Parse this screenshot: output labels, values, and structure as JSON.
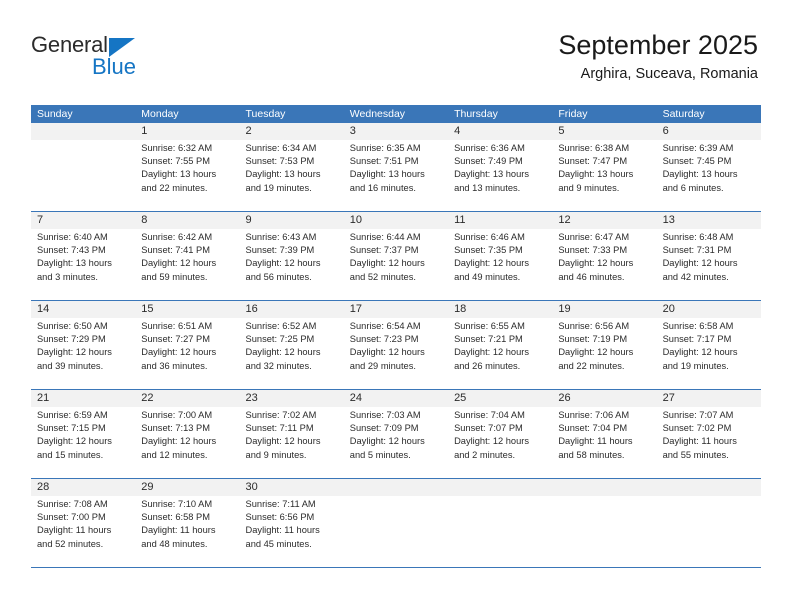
{
  "brand": {
    "name_top": "General",
    "name_bottom": "Blue",
    "triangle_color": "#1575c4"
  },
  "header": {
    "title": "September 2025",
    "subtitle": "Arghira, Suceava, Romania"
  },
  "theme": {
    "header_blue": "#3a76b8",
    "daynum_band": "#f2f2f2",
    "text": "#2b2b2b"
  },
  "calendar": {
    "weekdays": [
      "Sunday",
      "Monday",
      "Tuesday",
      "Wednesday",
      "Thursday",
      "Friday",
      "Saturday"
    ],
    "labels": {
      "sunrise": "Sunrise:",
      "sunset": "Sunset:",
      "daylight": "Daylight:"
    },
    "weeks": [
      [
        {
          "day": "",
          "sunrise": "",
          "sunset": "",
          "daylight_line1": "",
          "daylight_line2": ""
        },
        {
          "day": "1",
          "sunrise": "Sunrise: 6:32 AM",
          "sunset": "Sunset: 7:55 PM",
          "daylight_line1": "Daylight: 13 hours",
          "daylight_line2": "and 22 minutes."
        },
        {
          "day": "2",
          "sunrise": "Sunrise: 6:34 AM",
          "sunset": "Sunset: 7:53 PM",
          "daylight_line1": "Daylight: 13 hours",
          "daylight_line2": "and 19 minutes."
        },
        {
          "day": "3",
          "sunrise": "Sunrise: 6:35 AM",
          "sunset": "Sunset: 7:51 PM",
          "daylight_line1": "Daylight: 13 hours",
          "daylight_line2": "and 16 minutes."
        },
        {
          "day": "4",
          "sunrise": "Sunrise: 6:36 AM",
          "sunset": "Sunset: 7:49 PM",
          "daylight_line1": "Daylight: 13 hours",
          "daylight_line2": "and 13 minutes."
        },
        {
          "day": "5",
          "sunrise": "Sunrise: 6:38 AM",
          "sunset": "Sunset: 7:47 PM",
          "daylight_line1": "Daylight: 13 hours",
          "daylight_line2": "and 9 minutes."
        },
        {
          "day": "6",
          "sunrise": "Sunrise: 6:39 AM",
          "sunset": "Sunset: 7:45 PM",
          "daylight_line1": "Daylight: 13 hours",
          "daylight_line2": "and 6 minutes."
        }
      ],
      [
        {
          "day": "7",
          "sunrise": "Sunrise: 6:40 AM",
          "sunset": "Sunset: 7:43 PM",
          "daylight_line1": "Daylight: 13 hours",
          "daylight_line2": "and 3 minutes."
        },
        {
          "day": "8",
          "sunrise": "Sunrise: 6:42 AM",
          "sunset": "Sunset: 7:41 PM",
          "daylight_line1": "Daylight: 12 hours",
          "daylight_line2": "and 59 minutes."
        },
        {
          "day": "9",
          "sunrise": "Sunrise: 6:43 AM",
          "sunset": "Sunset: 7:39 PM",
          "daylight_line1": "Daylight: 12 hours",
          "daylight_line2": "and 56 minutes."
        },
        {
          "day": "10",
          "sunrise": "Sunrise: 6:44 AM",
          "sunset": "Sunset: 7:37 PM",
          "daylight_line1": "Daylight: 12 hours",
          "daylight_line2": "and 52 minutes."
        },
        {
          "day": "11",
          "sunrise": "Sunrise: 6:46 AM",
          "sunset": "Sunset: 7:35 PM",
          "daylight_line1": "Daylight: 12 hours",
          "daylight_line2": "and 49 minutes."
        },
        {
          "day": "12",
          "sunrise": "Sunrise: 6:47 AM",
          "sunset": "Sunset: 7:33 PM",
          "daylight_line1": "Daylight: 12 hours",
          "daylight_line2": "and 46 minutes."
        },
        {
          "day": "13",
          "sunrise": "Sunrise: 6:48 AM",
          "sunset": "Sunset: 7:31 PM",
          "daylight_line1": "Daylight: 12 hours",
          "daylight_line2": "and 42 minutes."
        }
      ],
      [
        {
          "day": "14",
          "sunrise": "Sunrise: 6:50 AM",
          "sunset": "Sunset: 7:29 PM",
          "daylight_line1": "Daylight: 12 hours",
          "daylight_line2": "and 39 minutes."
        },
        {
          "day": "15",
          "sunrise": "Sunrise: 6:51 AM",
          "sunset": "Sunset: 7:27 PM",
          "daylight_line1": "Daylight: 12 hours",
          "daylight_line2": "and 36 minutes."
        },
        {
          "day": "16",
          "sunrise": "Sunrise: 6:52 AM",
          "sunset": "Sunset: 7:25 PM",
          "daylight_line1": "Daylight: 12 hours",
          "daylight_line2": "and 32 minutes."
        },
        {
          "day": "17",
          "sunrise": "Sunrise: 6:54 AM",
          "sunset": "Sunset: 7:23 PM",
          "daylight_line1": "Daylight: 12 hours",
          "daylight_line2": "and 29 minutes."
        },
        {
          "day": "18",
          "sunrise": "Sunrise: 6:55 AM",
          "sunset": "Sunset: 7:21 PM",
          "daylight_line1": "Daylight: 12 hours",
          "daylight_line2": "and 26 minutes."
        },
        {
          "day": "19",
          "sunrise": "Sunrise: 6:56 AM",
          "sunset": "Sunset: 7:19 PM",
          "daylight_line1": "Daylight: 12 hours",
          "daylight_line2": "and 22 minutes."
        },
        {
          "day": "20",
          "sunrise": "Sunrise: 6:58 AM",
          "sunset": "Sunset: 7:17 PM",
          "daylight_line1": "Daylight: 12 hours",
          "daylight_line2": "and 19 minutes."
        }
      ],
      [
        {
          "day": "21",
          "sunrise": "Sunrise: 6:59 AM",
          "sunset": "Sunset: 7:15 PM",
          "daylight_line1": "Daylight: 12 hours",
          "daylight_line2": "and 15 minutes."
        },
        {
          "day": "22",
          "sunrise": "Sunrise: 7:00 AM",
          "sunset": "Sunset: 7:13 PM",
          "daylight_line1": "Daylight: 12 hours",
          "daylight_line2": "and 12 minutes."
        },
        {
          "day": "23",
          "sunrise": "Sunrise: 7:02 AM",
          "sunset": "Sunset: 7:11 PM",
          "daylight_line1": "Daylight: 12 hours",
          "daylight_line2": "and 9 minutes."
        },
        {
          "day": "24",
          "sunrise": "Sunrise: 7:03 AM",
          "sunset": "Sunset: 7:09 PM",
          "daylight_line1": "Daylight: 12 hours",
          "daylight_line2": "and 5 minutes."
        },
        {
          "day": "25",
          "sunrise": "Sunrise: 7:04 AM",
          "sunset": "Sunset: 7:07 PM",
          "daylight_line1": "Daylight: 12 hours",
          "daylight_line2": "and 2 minutes."
        },
        {
          "day": "26",
          "sunrise": "Sunrise: 7:06 AM",
          "sunset": "Sunset: 7:04 PM",
          "daylight_line1": "Daylight: 11 hours",
          "daylight_line2": "and 58 minutes."
        },
        {
          "day": "27",
          "sunrise": "Sunrise: 7:07 AM",
          "sunset": "Sunset: 7:02 PM",
          "daylight_line1": "Daylight: 11 hours",
          "daylight_line2": "and 55 minutes."
        }
      ],
      [
        {
          "day": "28",
          "sunrise": "Sunrise: 7:08 AM",
          "sunset": "Sunset: 7:00 PM",
          "daylight_line1": "Daylight: 11 hours",
          "daylight_line2": "and 52 minutes."
        },
        {
          "day": "29",
          "sunrise": "Sunrise: 7:10 AM",
          "sunset": "Sunset: 6:58 PM",
          "daylight_line1": "Daylight: 11 hours",
          "daylight_line2": "and 48 minutes."
        },
        {
          "day": "30",
          "sunrise": "Sunrise: 7:11 AM",
          "sunset": "Sunset: 6:56 PM",
          "daylight_line1": "Daylight: 11 hours",
          "daylight_line2": "and 45 minutes."
        },
        {
          "day": "",
          "sunrise": "",
          "sunset": "",
          "daylight_line1": "",
          "daylight_line2": ""
        },
        {
          "day": "",
          "sunrise": "",
          "sunset": "",
          "daylight_line1": "",
          "daylight_line2": ""
        },
        {
          "day": "",
          "sunrise": "",
          "sunset": "",
          "daylight_line1": "",
          "daylight_line2": ""
        },
        {
          "day": "",
          "sunrise": "",
          "sunset": "",
          "daylight_line1": "",
          "daylight_line2": ""
        }
      ]
    ]
  }
}
